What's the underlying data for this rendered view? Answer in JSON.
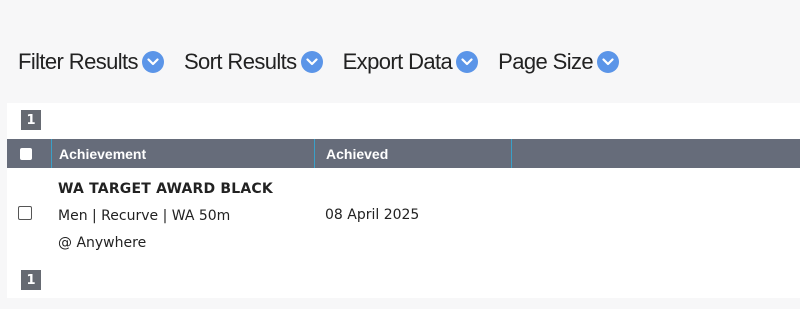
{
  "toolbar": {
    "items": [
      {
        "label": "Filter Results",
        "icon": "chevron-down-icon"
      },
      {
        "label": "Sort Results",
        "icon": "chevron-down-icon"
      },
      {
        "label": "Export Data",
        "icon": "chevron-down-icon"
      },
      {
        "label": "Page Size",
        "icon": "chevron-down-icon"
      }
    ],
    "accent_color": "#5b95e8"
  },
  "pagination": {
    "top_page": "1",
    "bottom_page": "1"
  },
  "table": {
    "columns": [
      "Achievement",
      "Achieved"
    ],
    "header_color": "#666c7a",
    "rows": [
      {
        "title": "WA TARGET AWARD BLACK",
        "detail": "Men | Recurve | WA 50m",
        "location": "@ Anywhere",
        "achieved": "08 April 2025"
      }
    ]
  }
}
